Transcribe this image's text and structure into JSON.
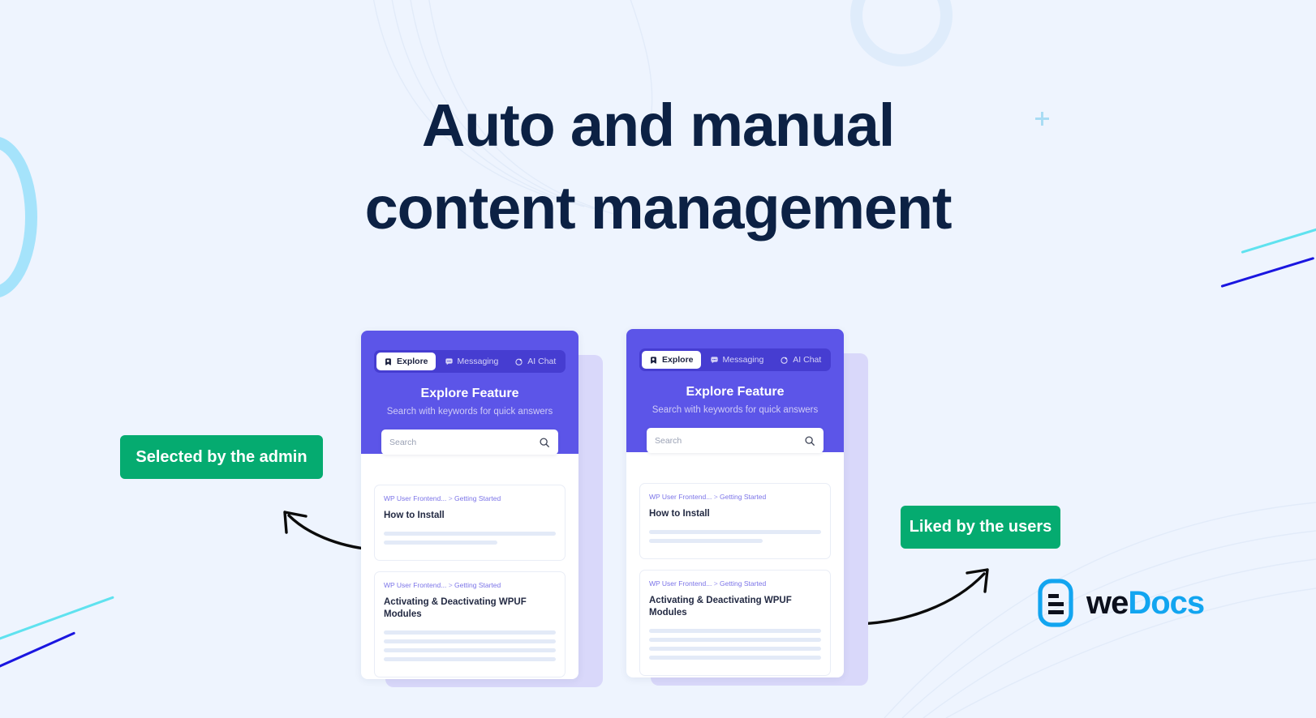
{
  "page": {
    "background_color": "#eef4fe",
    "heading_lines": [
      "Auto and manual",
      "content management"
    ],
    "heading_color": "#0c2144"
  },
  "badges": {
    "admin": {
      "label": "Selected by the admin",
      "color": "#05ab70"
    },
    "liked": {
      "label": "Liked by the users",
      "color": "#05ab70"
    }
  },
  "cards": [
    {
      "name": "explore-card-left",
      "tabs": [
        {
          "label": "Explore",
          "icon": "explore-icon",
          "active": true
        },
        {
          "label": "Messaging",
          "icon": "chat-bubble-icon",
          "active": false
        },
        {
          "label": "AI Chat",
          "icon": "ai-sparkle-icon",
          "active": false
        }
      ],
      "title": "Explore Feature",
      "subtitle": "Search with keywords for quick answers",
      "search_placeholder": "Search",
      "header_color": "#5c55e8",
      "docs": [
        {
          "breadcrumb_parent": "WP User Frontend...",
          "breadcrumb_sep": ">",
          "breadcrumb_child": "Getting Started",
          "title": "How to Install",
          "skeleton_widths": [
            "100%",
            "66%"
          ]
        },
        {
          "breadcrumb_parent": "WP User Frontend...",
          "breadcrumb_sep": ">",
          "breadcrumb_child": "Getting Started",
          "title": "Activating & Deactivating WPUF Modules",
          "skeleton_widths": [
            "100%",
            "100%",
            "100%",
            "100%"
          ]
        }
      ]
    },
    {
      "name": "explore-card-right",
      "tabs": [
        {
          "label": "Explore",
          "icon": "explore-icon",
          "active": true
        },
        {
          "label": "Messaging",
          "icon": "chat-bubble-icon",
          "active": false
        },
        {
          "label": "AI Chat",
          "icon": "ai-sparkle-icon",
          "active": false
        }
      ],
      "title": "Explore Feature",
      "subtitle": "Search with keywords for quick answers",
      "search_placeholder": "Search",
      "header_color": "#5c55e8",
      "docs": [
        {
          "breadcrumb_parent": "WP User Frontend...",
          "breadcrumb_sep": ">",
          "breadcrumb_child": "Getting Started",
          "title": "How to Install",
          "skeleton_widths": [
            "100%",
            "66%"
          ]
        },
        {
          "breadcrumb_parent": "WP User Frontend...",
          "breadcrumb_sep": ">",
          "breadcrumb_child": "Getting Started",
          "title": "Activating & Deactivating WPUF Modules",
          "skeleton_widths": [
            "100%",
            "100%",
            "100%",
            "100%"
          ]
        }
      ]
    }
  ],
  "logo": {
    "text_primary": "we",
    "text_accent": "Docs",
    "accent_color": "#12a5f0"
  }
}
